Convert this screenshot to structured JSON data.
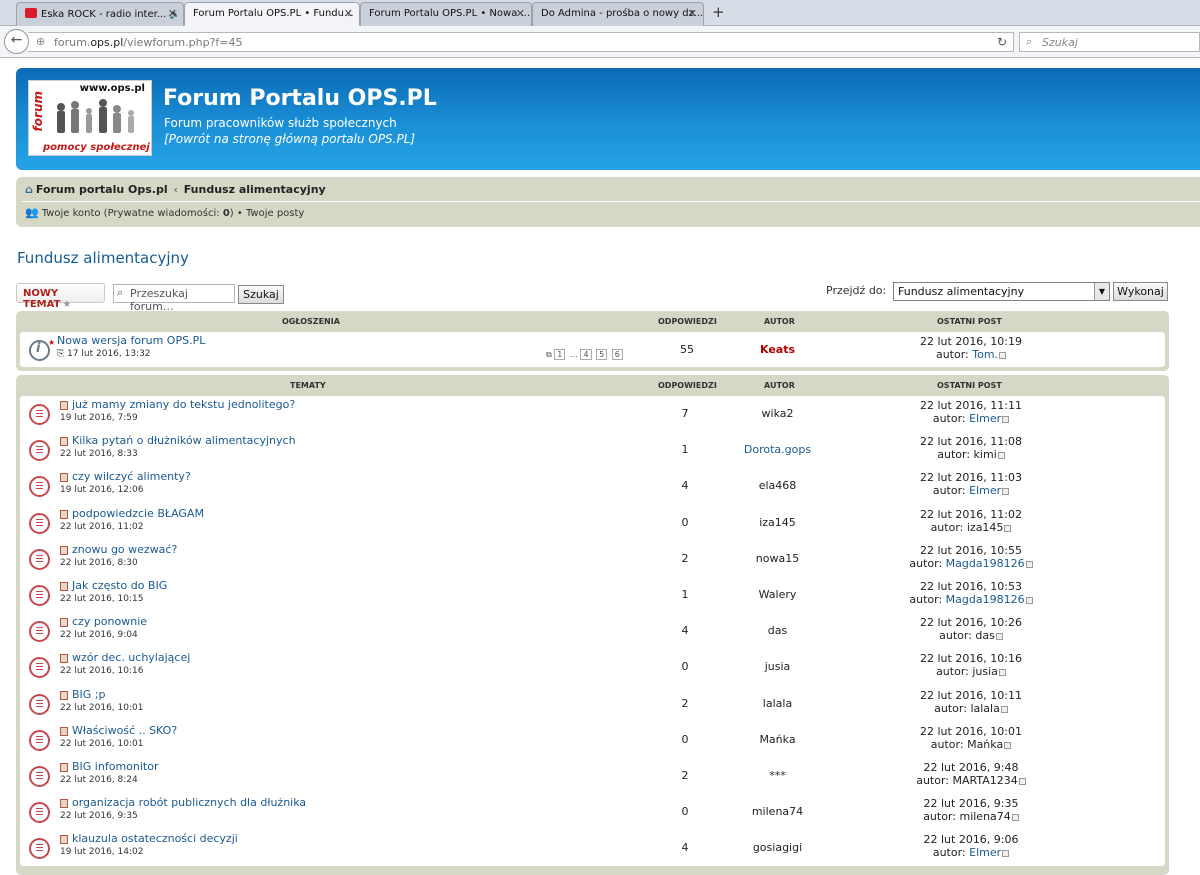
{
  "browser": {
    "tabs": [
      {
        "label": "Eska ROCK - radio inter...",
        "speaker": "🔊"
      },
      {
        "label": "Forum Portalu OPS.PL • Fundu..."
      },
      {
        "label": "Forum Portalu OPS.PL • Nowa ..."
      },
      {
        "label": "Do Admina - prośba o nowy dz..."
      }
    ],
    "new_tab": "+",
    "url_prefix": "forum.",
    "url_host": "ops.pl",
    "url_path": "/viewforum.php?f=45",
    "search_placeholder": "Szukaj"
  },
  "header": {
    "logo_www": "www.ops.pl",
    "logo_forum": "forum",
    "logo_pomocy": "pomocy społecznej",
    "site_title": "Forum Portalu OPS.PL",
    "site_desc": "Forum pracowników służb społecznych",
    "site_back": "[Powrót na stronę główną portalu OPS.PL]"
  },
  "breadcrumbs": {
    "home": "Forum portalu Ops.pl",
    "sep": "‹",
    "current": "Fundusz alimentacyjny"
  },
  "account": {
    "account_link": "Twoje konto",
    "pm_open": " (Prywatne wiadomości: ",
    "pm_count": "0",
    "pm_close": ")",
    "bullet": " • ",
    "posts_link": "Twoje posty"
  },
  "page": {
    "title": "Fundusz alimentacyjny",
    "new_topic_label": "NOWY TEMAT",
    "search_placeholder": "Przeszukaj forum…",
    "search_button": "Szukaj",
    "jump_label": "Przejdź do:",
    "jump_value": "Fundusz alimentacyjny",
    "jump_button": "Wykonaj"
  },
  "announcements": {
    "headers": {
      "title": "OGŁOSZENIA",
      "replies": "ODPOWIEDZI",
      "author": "AUTOR",
      "last": "OSTATNI POST"
    },
    "items": [
      {
        "title": "Nowa wersja forum OPS.PL",
        "date": "17 lut 2016, 13:32",
        "pages": [
          "1",
          "…",
          "4",
          "5",
          "6"
        ],
        "replies": "55",
        "author": "Keats",
        "last_date": "22 lut 2016, 10:19",
        "last_prefix": "autor: ",
        "last_author": "Tom."
      }
    ]
  },
  "topics": {
    "headers": {
      "title": "TEMATY",
      "replies": "ODPOWIEDZI",
      "author": "AUTOR",
      "last": "OSTATNI POST"
    },
    "items": [
      {
        "title": "już mamy zmiany do tekstu jednolitego?",
        "date": "19 lut 2016, 7:59",
        "replies": "7",
        "author": "wika2",
        "last_date": "22 lut 2016, 11:11",
        "last_author": "Elmer"
      },
      {
        "title": "Kilka pytań o dłużników alimentacyjnych",
        "date": "22 lut 2016, 8:33",
        "replies": "1",
        "author": "Dorota.gops",
        "last_date": "22 lut 2016, 11:08",
        "last_author": "kimi"
      },
      {
        "title": "czy wilczyć alimenty?",
        "date": "19 lut 2016, 12:06",
        "replies": "4",
        "author": "ela468",
        "last_date": "22 lut 2016, 11:03",
        "last_author": "Elmer"
      },
      {
        "title": "podpowiedzcie BŁAGAM",
        "date": "22 lut 2016, 11:02",
        "replies": "0",
        "author": "iza145",
        "last_date": "22 lut 2016, 11:02",
        "last_author": "iza145"
      },
      {
        "title": "znowu go wezwać?",
        "date": "22 lut 2016, 8:30",
        "replies": "2",
        "author": "nowa15",
        "last_date": "22 lut 2016, 10:55",
        "last_author": "Magda198126"
      },
      {
        "title": "Jak często do BIG",
        "date": "22 lut 2016, 10:15",
        "replies": "1",
        "author": "Walery",
        "last_date": "22 lut 2016, 10:53",
        "last_author": "Magda198126"
      },
      {
        "title": "czy ponownie",
        "date": "22 lut 2016, 9:04",
        "replies": "4",
        "author": "das",
        "last_date": "22 lut 2016, 10:26",
        "last_author": "das"
      },
      {
        "title": "wzór dec. uchylającej",
        "date": "22 lut 2016, 10:16",
        "replies": "0",
        "author": "jusia",
        "last_date": "22 lut 2016, 10:16",
        "last_author": "jusia"
      },
      {
        "title": "BIG ;p",
        "date": "22 lut 2016, 10:01",
        "replies": "2",
        "author": "lalala",
        "last_date": "22 lut 2016, 10:11",
        "last_author": "lalala"
      },
      {
        "title": "Właściwość .. SKO?",
        "date": "22 lut 2016, 10:01",
        "replies": "0",
        "author": "Mańka",
        "last_date": "22 lut 2016, 10:01",
        "last_author": "Mańka"
      },
      {
        "title": "BIG infomonitor",
        "date": "22 lut 2016, 8:24",
        "replies": "2",
        "author": "***",
        "last_date": "22 lut 2016, 9:48",
        "last_author": "MARTA1234"
      },
      {
        "title": "organizacja robót publicznych dla dłużnika",
        "date": "22 lut 2016, 9:35",
        "replies": "0",
        "author": "milena74",
        "last_date": "22 lut 2016, 9:35",
        "last_author": "milena74"
      },
      {
        "title": "klauzula ostateczności decyzji",
        "date": "19 lut 2016, 14:02",
        "replies": "4",
        "author": "gosiagigi",
        "last_date": "22 lut 2016, 9:06",
        "last_author": "Elmer"
      }
    ],
    "last_prefix": "autor: "
  },
  "colors": {
    "banner": "#1a8fd6",
    "panel": "#d6d7c5",
    "link": "#1a5a91",
    "new_topic": "#b0211b"
  }
}
